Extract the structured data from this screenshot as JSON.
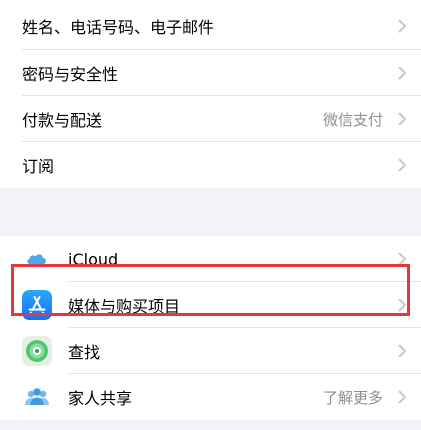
{
  "account_section": {
    "items": [
      {
        "label": "姓名、电话号码、电子邮件"
      },
      {
        "label": "密码与安全性"
      },
      {
        "label": "付款与配送",
        "value": "微信支付"
      },
      {
        "label": "订阅"
      }
    ]
  },
  "services_section": {
    "items": [
      {
        "label": "iCloud",
        "icon": "icloud-icon"
      },
      {
        "label": "媒体与购买项目",
        "icon": "app-store-icon"
      },
      {
        "label": "查找",
        "icon": "find-my-icon"
      },
      {
        "label": "家人共享",
        "icon": "family-sharing-icon",
        "value": "了解更多"
      }
    ]
  },
  "colors": {
    "highlight_border": "#e8363d",
    "chevron": "#c7c7cc",
    "secondary_text": "#8e8e93",
    "app_store_blue": "#1e8ef7",
    "icloud_blue": "#4aa8f0",
    "find_my_green": "#4cc86a"
  }
}
